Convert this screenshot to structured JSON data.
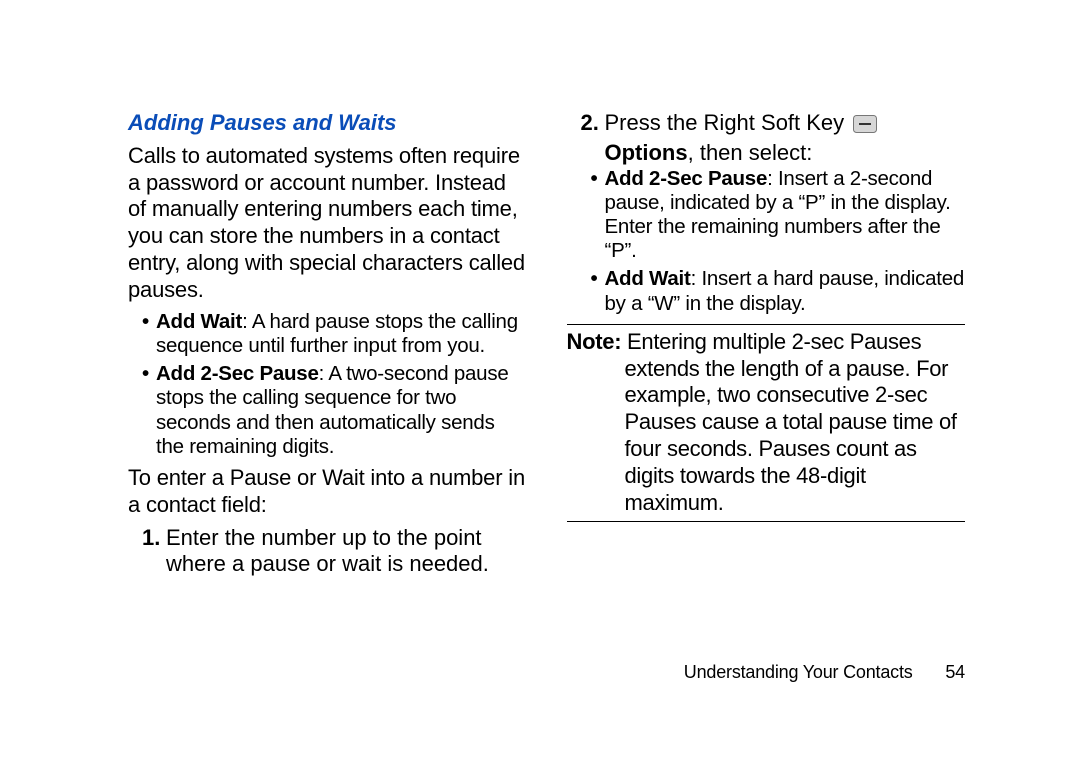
{
  "heading": "Adding Pauses and Waits",
  "intro": "Calls to automated systems often require a password or account number. Instead of manually entering numbers each time, you can store the numbers in a contact entry, along with special characters called pauses.",
  "bullets": {
    "addWait": {
      "label": "Add Wait",
      "text": ": A hard pause stops the calling sequence until further input from you."
    },
    "add2Sec": {
      "label": "Add 2-Sec Pause",
      "text": ": A two-second pause stops the calling sequence for two seconds and then automatically sends the remaining digits."
    }
  },
  "lead2": "To enter a Pause or Wait into a number in a contact field:",
  "steps": {
    "s1": {
      "n": "1.",
      "a": "Enter the number up to the point",
      "b": "where a pause or wait is needed."
    },
    "s2": {
      "n": "2.",
      "pre": "Press the Right Soft Key ",
      "options": "Options",
      "post": ", then select:"
    }
  },
  "subBullets": {
    "sbA": {
      "label": "Add 2-Sec Pause",
      "text": ":  Insert a 2-second pause, indicated by a “P” in the display. Enter the remaining numbers after the “P”."
    },
    "sbB": {
      "label": "Add Wait",
      "text": ": Insert a hard pause, indicated by a “W” in the display."
    }
  },
  "note": {
    "label": "Note:",
    "text": " Entering multiple 2-sec Pauses extends the length of a pause. For example, two consecutive 2-sec Pauses cause a total pause time of four seconds. Pauses count as digits towards the 48-digit maximum."
  },
  "footer": {
    "section": "Understanding Your Contacts",
    "page": "54"
  }
}
